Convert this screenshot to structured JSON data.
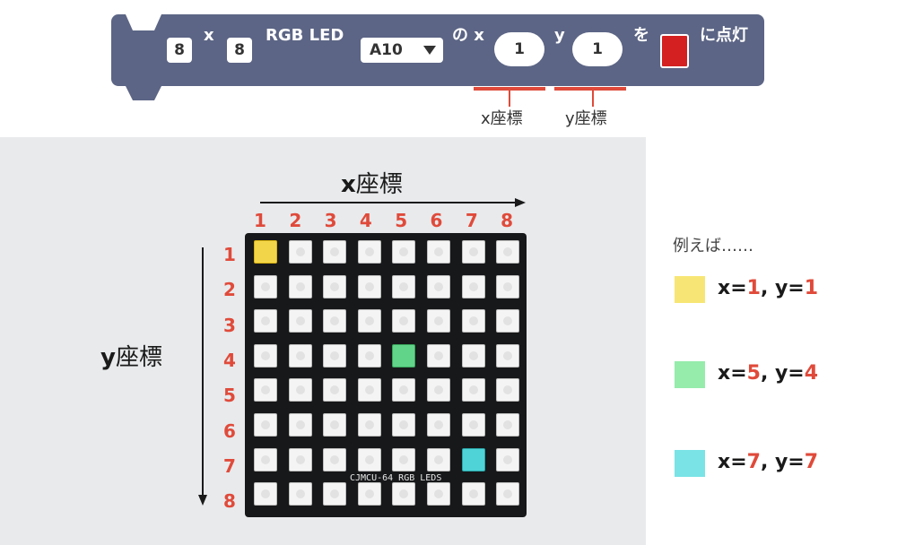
{
  "block": {
    "rows": "8",
    "x_sep": "x",
    "cols": "8",
    "label": "RGB LED",
    "pin": "A10",
    "no_x": "の x",
    "x_value": "1",
    "y_label": "y",
    "y_value": "1",
    "wo": "を",
    "color": "#d42020",
    "suffix": "に点灯"
  },
  "callouts": {
    "x": "x座標",
    "y": "y座標"
  },
  "axes": {
    "x_bold": "x",
    "x_title": "座標",
    "y_bold": "y",
    "y_title": "座標"
  },
  "columns": [
    "1",
    "2",
    "3",
    "4",
    "5",
    "6",
    "7",
    "8"
  ],
  "rows": [
    "1",
    "2",
    "3",
    "4",
    "5",
    "6",
    "7",
    "8"
  ],
  "board_label": "CJMCU-64 RGB LEDS",
  "example_title": "例えば……",
  "examples": [
    {
      "color": "#f7e675",
      "x_label": "x=",
      "x": "1",
      "sep": ", y=",
      "y": "1"
    },
    {
      "color": "#95ecab",
      "x_label": "x=",
      "x": "5",
      "sep": ", y=",
      "y": "4"
    },
    {
      "color": "#7ae3e6",
      "x_label": "x=",
      "x": "7",
      "sep": ", y=",
      "y": "7"
    }
  ]
}
